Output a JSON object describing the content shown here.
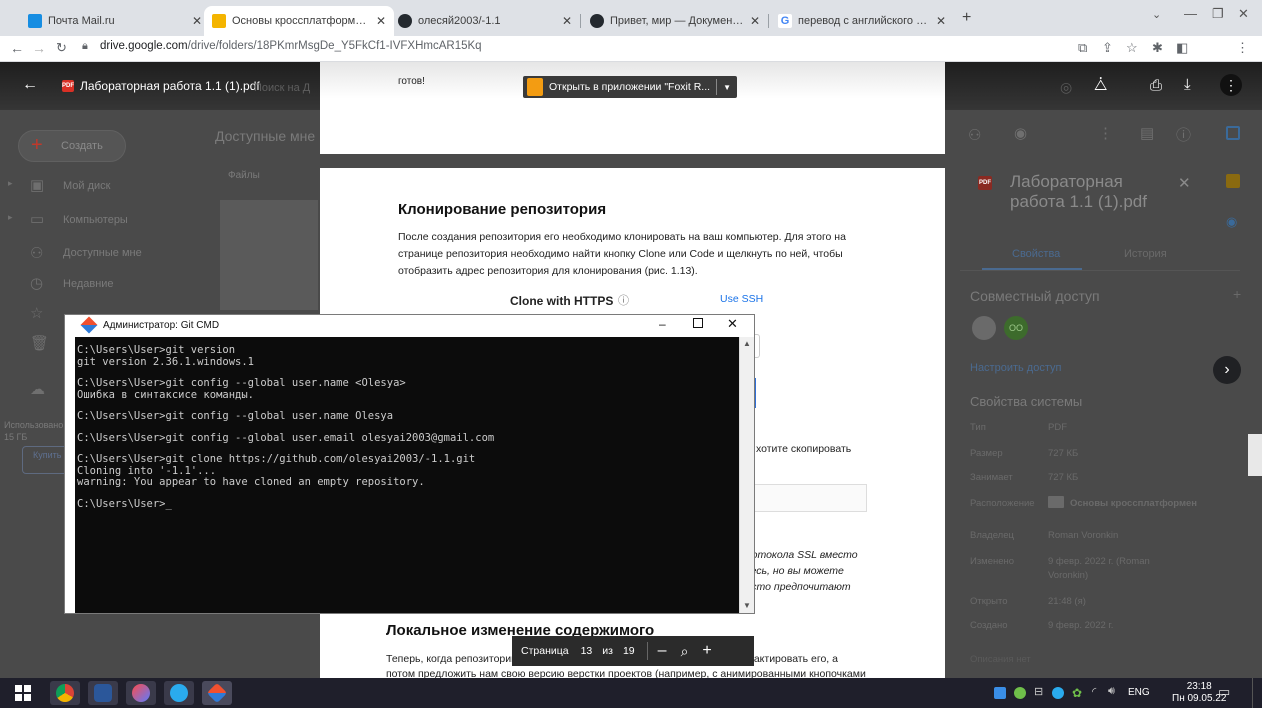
{
  "browser": {
    "tabs": [
      {
        "label": "Почта Mail.ru",
        "favicon_color": "#168de2"
      },
      {
        "label": "Основы кроссплатформенного",
        "favicon_color": "#f4b400"
      },
      {
        "label": "олесяй2003/-1.1",
        "favicon_color": "#24292f"
      },
      {
        "label": "Привет, мир — Документы GitH",
        "favicon_color": "#24292f"
      },
      {
        "label": "перевод с английского на русс",
        "favicon_color": "#4285f4"
      }
    ],
    "url_host": "drive.google.com",
    "url_path": "/drive/folders/18PKmrMsgDe_Y5FkCf1-IVFXHmcAR15Kq"
  },
  "pdf": {
    "file_title": "Лабораторная работа 1.1 (1).pdf",
    "search_placeholder": "Поиск на Д",
    "foxit_label": "Открыть в приложении \"Foxit R...",
    "top_text": "готов!",
    "section1_title": "Клонирование репозитория",
    "section1_lines": [
      "После создания репозитория его необходимо клонировать на ваш компьютер. Для этого на",
      "странице репозитория необходимо найти кнопку  Clone  или Code  и щелкнуть по ней, чтобы",
      "отобразить адрес репозитория для клонирования (рис. 1.13)."
    ],
    "clone_https": "Clone with HTTPS",
    "use_ssh": "Use SSH",
    "copy_text": "хотите скопировать",
    "ssl_lines": [
      "протокола SSL вместо",
      "здесь, но вы можете",
      "часто предпочитают"
    ],
    "section2_title": "Локальное изменение содержимого",
    "section2_lines": [
      "Теперь, когда репозиторий скопирован на ваш компьютер, вы хотите отредактировать его, а",
      "потом предложить нам свою версию верстки проектов (например, с анимированными кнопочками"
    ],
    "page_label": "Страница",
    "page_current": "13",
    "page_of": "из",
    "page_total": "19"
  },
  "drive": {
    "create_label": "Создать",
    "header": "Доступные мне",
    "files_label": "Файлы",
    "nav": [
      "Мой диск",
      "Компьютеры",
      "Доступные мне",
      "Недавние",
      "Помеченные",
      "Корзина",
      "Хранилище"
    ],
    "storage_used": "Использовано",
    "storage_total": "15 ГБ",
    "buy_label": "Купить место"
  },
  "details": {
    "title_line1": "Лабораторная",
    "title_line2": "работа 1.1 (1).pdf",
    "tab_props": "Свойства",
    "tab_history": "История",
    "shared_header": "Совместный доступ",
    "avatar_initials": "OO",
    "manage_access": "Настроить доступ",
    "sys_props": "Свойства системы",
    "rows": [
      {
        "k": "Тип",
        "v": "PDF"
      },
      {
        "k": "Размер",
        "v": "727 КБ"
      },
      {
        "k": "Занимает",
        "v": "727 КБ"
      },
      {
        "k": "Расположение",
        "v": "Основы кроссплатформен"
      },
      {
        "k": "Владелец",
        "v": "Roman Voronkin"
      },
      {
        "k": "Изменено",
        "v": "9 февр. 2022 г. (Roman"
      },
      {
        "k": "",
        "v": "Voronkin)"
      },
      {
        "k": "Открыто",
        "v": "21:48 (я)"
      },
      {
        "k": "Создано",
        "v": "9 февр. 2022 г."
      }
    ],
    "description": "Описания нет"
  },
  "cmd": {
    "title": "Администратор: Git CMD",
    "lines": [
      "C:\\Users\\User>git version",
      "git version 2.36.1.windows.1",
      "",
      "C:\\Users\\User>git config --global user.name <Olesya>",
      "Ошибка в синтаксисе команды.",
      "",
      "C:\\Users\\User>git config --global user.name Olesya",
      "",
      "C:\\Users\\User>git config --global user.email olesyai2003@gmail.com",
      "",
      "C:\\Users\\User>git clone https://github.com/olesyai2003/-1.1.git",
      "Cloning into '-1.1'...",
      "warning: You appear to have cloned an empty repository.",
      "",
      "C:\\Users\\User>_"
    ]
  },
  "taskbar": {
    "lang": "ENG",
    "time": "23:18",
    "date": "Пн 09.05.22"
  }
}
